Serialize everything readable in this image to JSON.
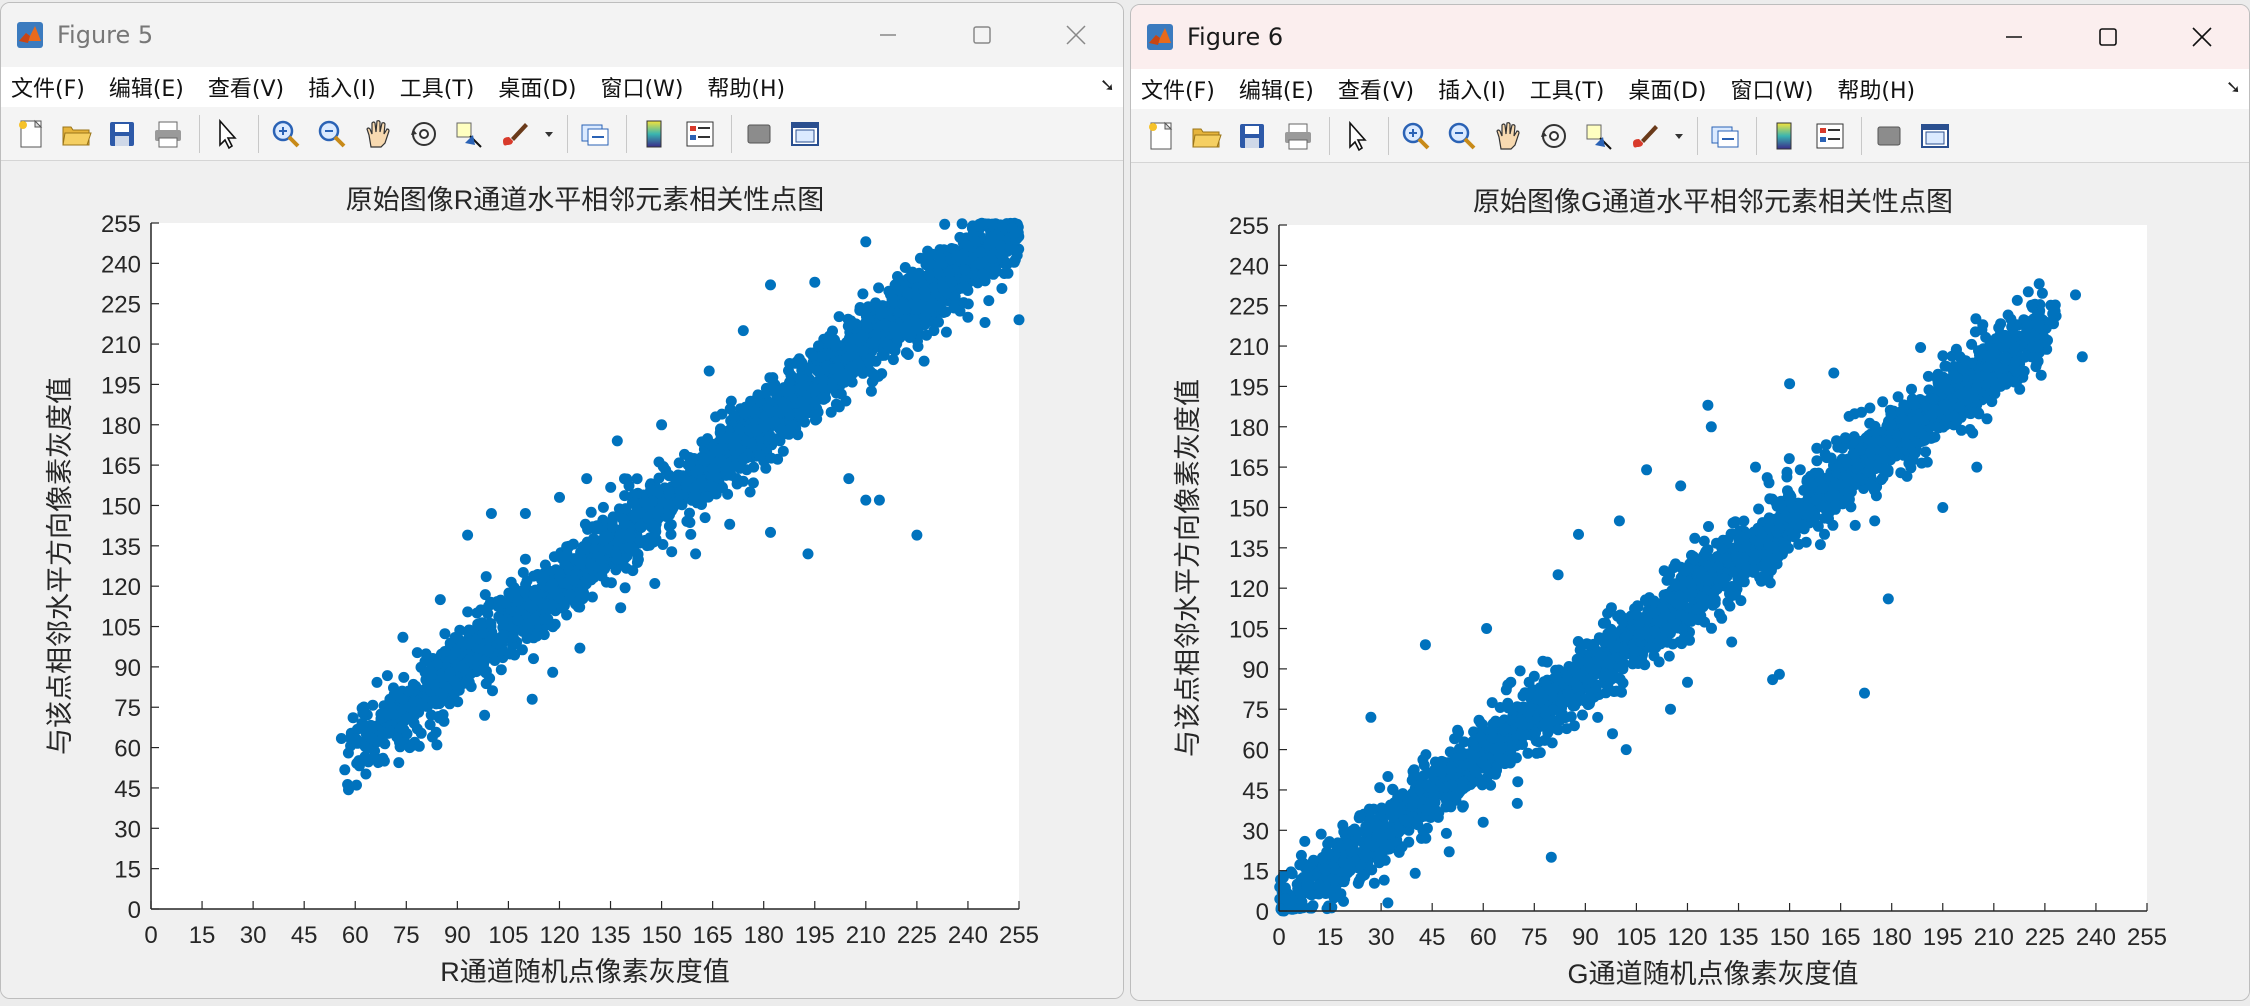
{
  "menu_labels": [
    "文件(F)",
    "编辑(E)",
    "查看(V)",
    "插入(I)",
    "工具(T)",
    "桌面(D)",
    "窗口(W)",
    "帮助(H)"
  ],
  "toolbar_icons": [
    "new-figure-icon",
    "open-file-icon",
    "save-icon",
    "print-icon",
    "edit-plot-icon",
    "zoom-in-icon",
    "zoom-out-icon",
    "pan-icon",
    "rotate-3d-icon",
    "data-cursor-icon",
    "brush-icon",
    "brush-dropdown-icon",
    "link-plot-icon",
    "colorbar-icon",
    "legend-icon",
    "hide-plot-tools-icon",
    "show-plot-tools-icon"
  ],
  "windows": [
    {
      "title": "Figure 5",
      "focused": false,
      "menu_dock_icon": "dock-arrow-icon"
    },
    {
      "title": "Figure 6",
      "focused": true,
      "menu_dock_icon": "dock-arrow-icon"
    }
  ],
  "colors": {
    "marker": "#0072BD",
    "axes_bg": "#ffffff",
    "figure_bg": "#f0f0f0",
    "focused_titlebar": "#fbeeee",
    "unfocused_titlebar": "#f3f3f3"
  },
  "chart_data": [
    {
      "type": "scatter",
      "title": "原始图像R通道水平相邻元素相关性点图",
      "xlabel": "R通道随机点像素灰度值",
      "ylabel": "与该点相邻水平方向像素灰度值",
      "xlim": [
        0,
        255
      ],
      "ylim": [
        0,
        255
      ],
      "ticks": [
        "0",
        "15",
        "30",
        "45",
        "60",
        "75",
        "90",
        "105",
        "120",
        "135",
        "150",
        "165",
        "180",
        "195",
        "210",
        "225",
        "240",
        "255"
      ],
      "grid": false,
      "points_cloud": {
        "x_min": 58,
        "x_max": 255,
        "slope": 1.0,
        "spread": 7
      },
      "outliers": [
        {
          "x": 58,
          "y": 58
        },
        {
          "x": 62,
          "y": 69
        },
        {
          "x": 74,
          "y": 101
        },
        {
          "x": 85,
          "y": 115
        },
        {
          "x": 93,
          "y": 139
        },
        {
          "x": 100,
          "y": 147
        },
        {
          "x": 110,
          "y": 147
        },
        {
          "x": 120,
          "y": 153
        },
        {
          "x": 128,
          "y": 160
        },
        {
          "x": 137,
          "y": 174
        },
        {
          "x": 150,
          "y": 180
        },
        {
          "x": 164,
          "y": 200
        },
        {
          "x": 174,
          "y": 215
        },
        {
          "x": 182,
          "y": 232
        },
        {
          "x": 195,
          "y": 233
        },
        {
          "x": 210,
          "y": 248
        },
        {
          "x": 214,
          "y": 152
        },
        {
          "x": 225,
          "y": 139
        },
        {
          "x": 192,
          "y": 181
        },
        {
          "x": 172,
          "y": 160
        },
        {
          "x": 182,
          "y": 140
        },
        {
          "x": 193,
          "y": 132
        },
        {
          "x": 205,
          "y": 160
        },
        {
          "x": 210,
          "y": 152
        },
        {
          "x": 255,
          "y": 219
        },
        {
          "x": 245,
          "y": 218
        },
        {
          "x": 230,
          "y": 215
        },
        {
          "x": 240,
          "y": 220
        },
        {
          "x": 76,
          "y": 60
        },
        {
          "x": 73,
          "y": 62
        },
        {
          "x": 84,
          "y": 61
        },
        {
          "x": 98,
          "y": 72
        },
        {
          "x": 112,
          "y": 78
        },
        {
          "x": 118,
          "y": 88
        },
        {
          "x": 126,
          "y": 97
        },
        {
          "x": 138,
          "y": 112
        },
        {
          "x": 148,
          "y": 121
        },
        {
          "x": 160,
          "y": 132
        },
        {
          "x": 170,
          "y": 143
        },
        {
          "x": 176,
          "y": 155
        }
      ]
    },
    {
      "type": "scatter",
      "title": "原始图像G通道水平相邻元素相关性点图",
      "xlabel": "G通道随机点像素灰度值",
      "ylabel": "与该点相邻水平方向像素灰度值",
      "xlim": [
        0,
        255
      ],
      "ylim": [
        0,
        255
      ],
      "ticks": [
        "0",
        "15",
        "30",
        "45",
        "60",
        "75",
        "90",
        "105",
        "120",
        "135",
        "150",
        "165",
        "180",
        "195",
        "210",
        "225",
        "240",
        "255"
      ],
      "grid": false,
      "points_cloud": {
        "x_min": 0,
        "x_max": 225,
        "slope": 0.97,
        "spread": 7
      },
      "outliers": [
        {
          "x": 234,
          "y": 229
        },
        {
          "x": 236,
          "y": 206
        },
        {
          "x": 228,
          "y": 223
        },
        {
          "x": 220,
          "y": 218
        },
        {
          "x": 172,
          "y": 81
        },
        {
          "x": 147,
          "y": 88
        },
        {
          "x": 145,
          "y": 86
        },
        {
          "x": 179,
          "y": 116
        },
        {
          "x": 127,
          "y": 180
        },
        {
          "x": 126,
          "y": 188
        },
        {
          "x": 150,
          "y": 196
        },
        {
          "x": 163,
          "y": 200
        },
        {
          "x": 188,
          "y": 183
        },
        {
          "x": 203,
          "y": 179
        },
        {
          "x": 108,
          "y": 164
        },
        {
          "x": 100,
          "y": 145
        },
        {
          "x": 80,
          "y": 20
        },
        {
          "x": 32,
          "y": 3
        },
        {
          "x": 10,
          "y": 2
        },
        {
          "x": 27,
          "y": 72
        },
        {
          "x": 32,
          "y": 50
        },
        {
          "x": 43,
          "y": 99
        },
        {
          "x": 61,
          "y": 105
        },
        {
          "x": 82,
          "y": 125
        },
        {
          "x": 88,
          "y": 140
        },
        {
          "x": 118,
          "y": 158
        },
        {
          "x": 140,
          "y": 165
        },
        {
          "x": 158,
          "y": 172
        },
        {
          "x": 102,
          "y": 60
        },
        {
          "x": 115,
          "y": 75
        },
        {
          "x": 120,
          "y": 85
        },
        {
          "x": 133,
          "y": 100
        },
        {
          "x": 60,
          "y": 33
        },
        {
          "x": 70,
          "y": 40
        },
        {
          "x": 50,
          "y": 22
        },
        {
          "x": 40,
          "y": 14
        },
        {
          "x": 195,
          "y": 150
        },
        {
          "x": 205,
          "y": 165
        },
        {
          "x": 175,
          "y": 145
        },
        {
          "x": 212,
          "y": 195
        }
      ]
    }
  ]
}
